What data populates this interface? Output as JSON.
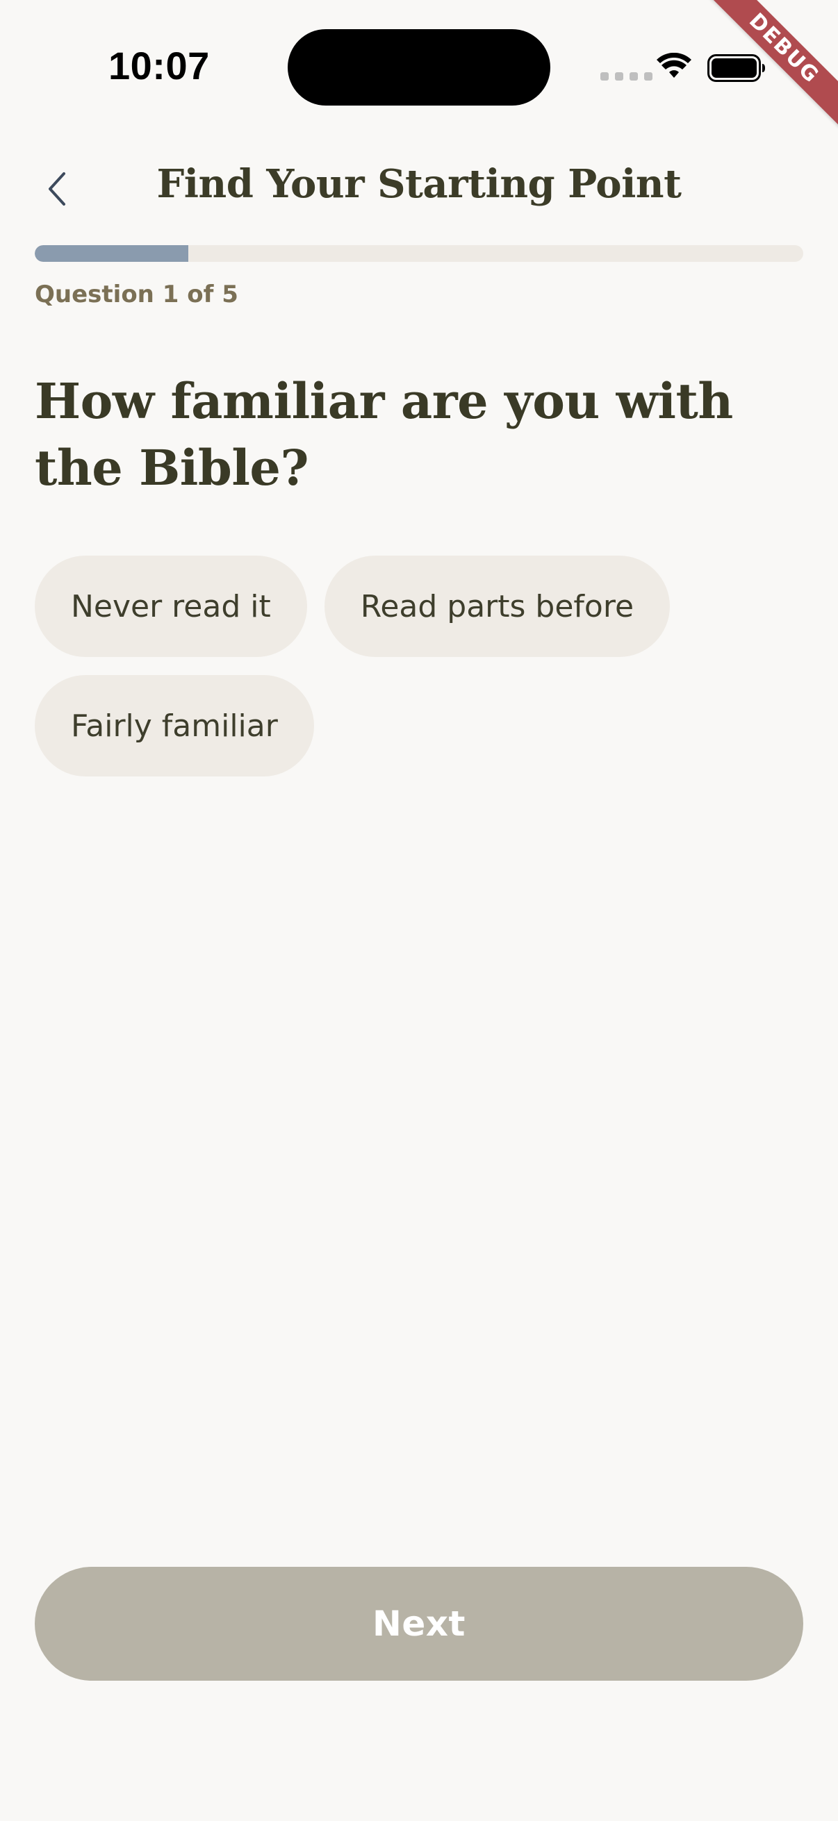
{
  "status_bar": {
    "time": "10:07"
  },
  "debug_banner": {
    "label": "DEBUG",
    "color": "#B04B4F"
  },
  "header": {
    "title": "Find Your Starting Point",
    "back_icon": "chevron-left-icon"
  },
  "progress": {
    "current": 1,
    "total": 5,
    "fraction": 0.2,
    "label": "Question 1 of 5",
    "fill_color": "#8A9BAE",
    "track_color": "#EEEAE4"
  },
  "question": {
    "text": "How familiar are you with the Bible?"
  },
  "options": [
    {
      "label": "Never read it"
    },
    {
      "label": "Read parts before"
    },
    {
      "label": "Fairly familiar"
    }
  ],
  "next_button": {
    "label": "Next",
    "color": "#B7B3A6"
  }
}
